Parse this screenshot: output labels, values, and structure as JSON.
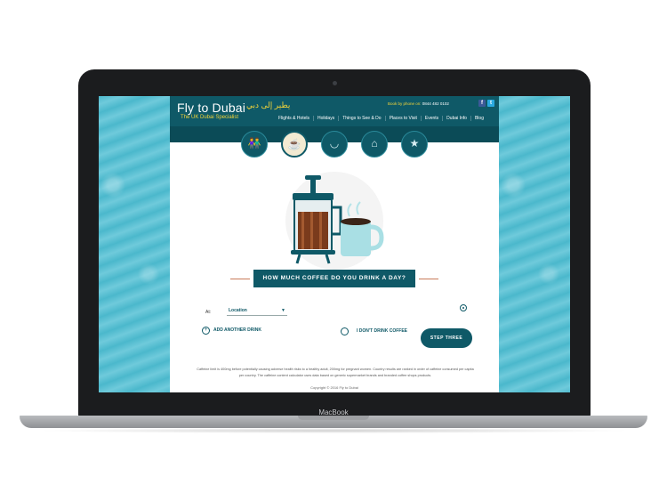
{
  "site": {
    "title": "Fly to Dubai",
    "arabic": "يطير إلى دبي",
    "tagline": "The UK Dubai Specialist",
    "phone_label": "Book by phone on:",
    "phone_number": "0844 482 0102",
    "social": [
      "f",
      "t"
    ],
    "nav": [
      "Flights & Hotels",
      "Holidays",
      "Things to See & Do",
      "Places to Visit",
      "Events",
      "Dubai Info",
      "Blog"
    ]
  },
  "steps": [
    {
      "icon": "person-icon",
      "glyph": "👫"
    },
    {
      "icon": "coffee-glass-icon",
      "glyph": "☕"
    },
    {
      "icon": "cup-icon",
      "glyph": "◡"
    },
    {
      "icon": "bottle-icon",
      "glyph": "⌂"
    },
    {
      "icon": "star-icon",
      "glyph": "★"
    }
  ],
  "question": "HOW MUCH COFFEE DO YOU DRINK A DAY?",
  "form": {
    "at_label": "At:",
    "location_value": "Location",
    "add_drink": "ADD ANOTHER DRINK",
    "no_coffee": "I DON'T DRINK COFFEE",
    "next_button": "STEP THREE"
  },
  "disclaimer": "Caffeine limit is 400mg before potentially causing adverse health risks to a healthy adult, 200mg for pregnant women. Country results are ranked in order of caffeine consumed per capita per country. The caffeine content calculator uses data based on generic supermarket brands and branded coffee shops products.",
  "copyright": "Copyright © 2016 Fly to Dubai",
  "device_brand": "MacBook",
  "colors": {
    "primary": "#0f5967",
    "accent": "#f2d43a",
    "water": "#5ec3d6"
  }
}
